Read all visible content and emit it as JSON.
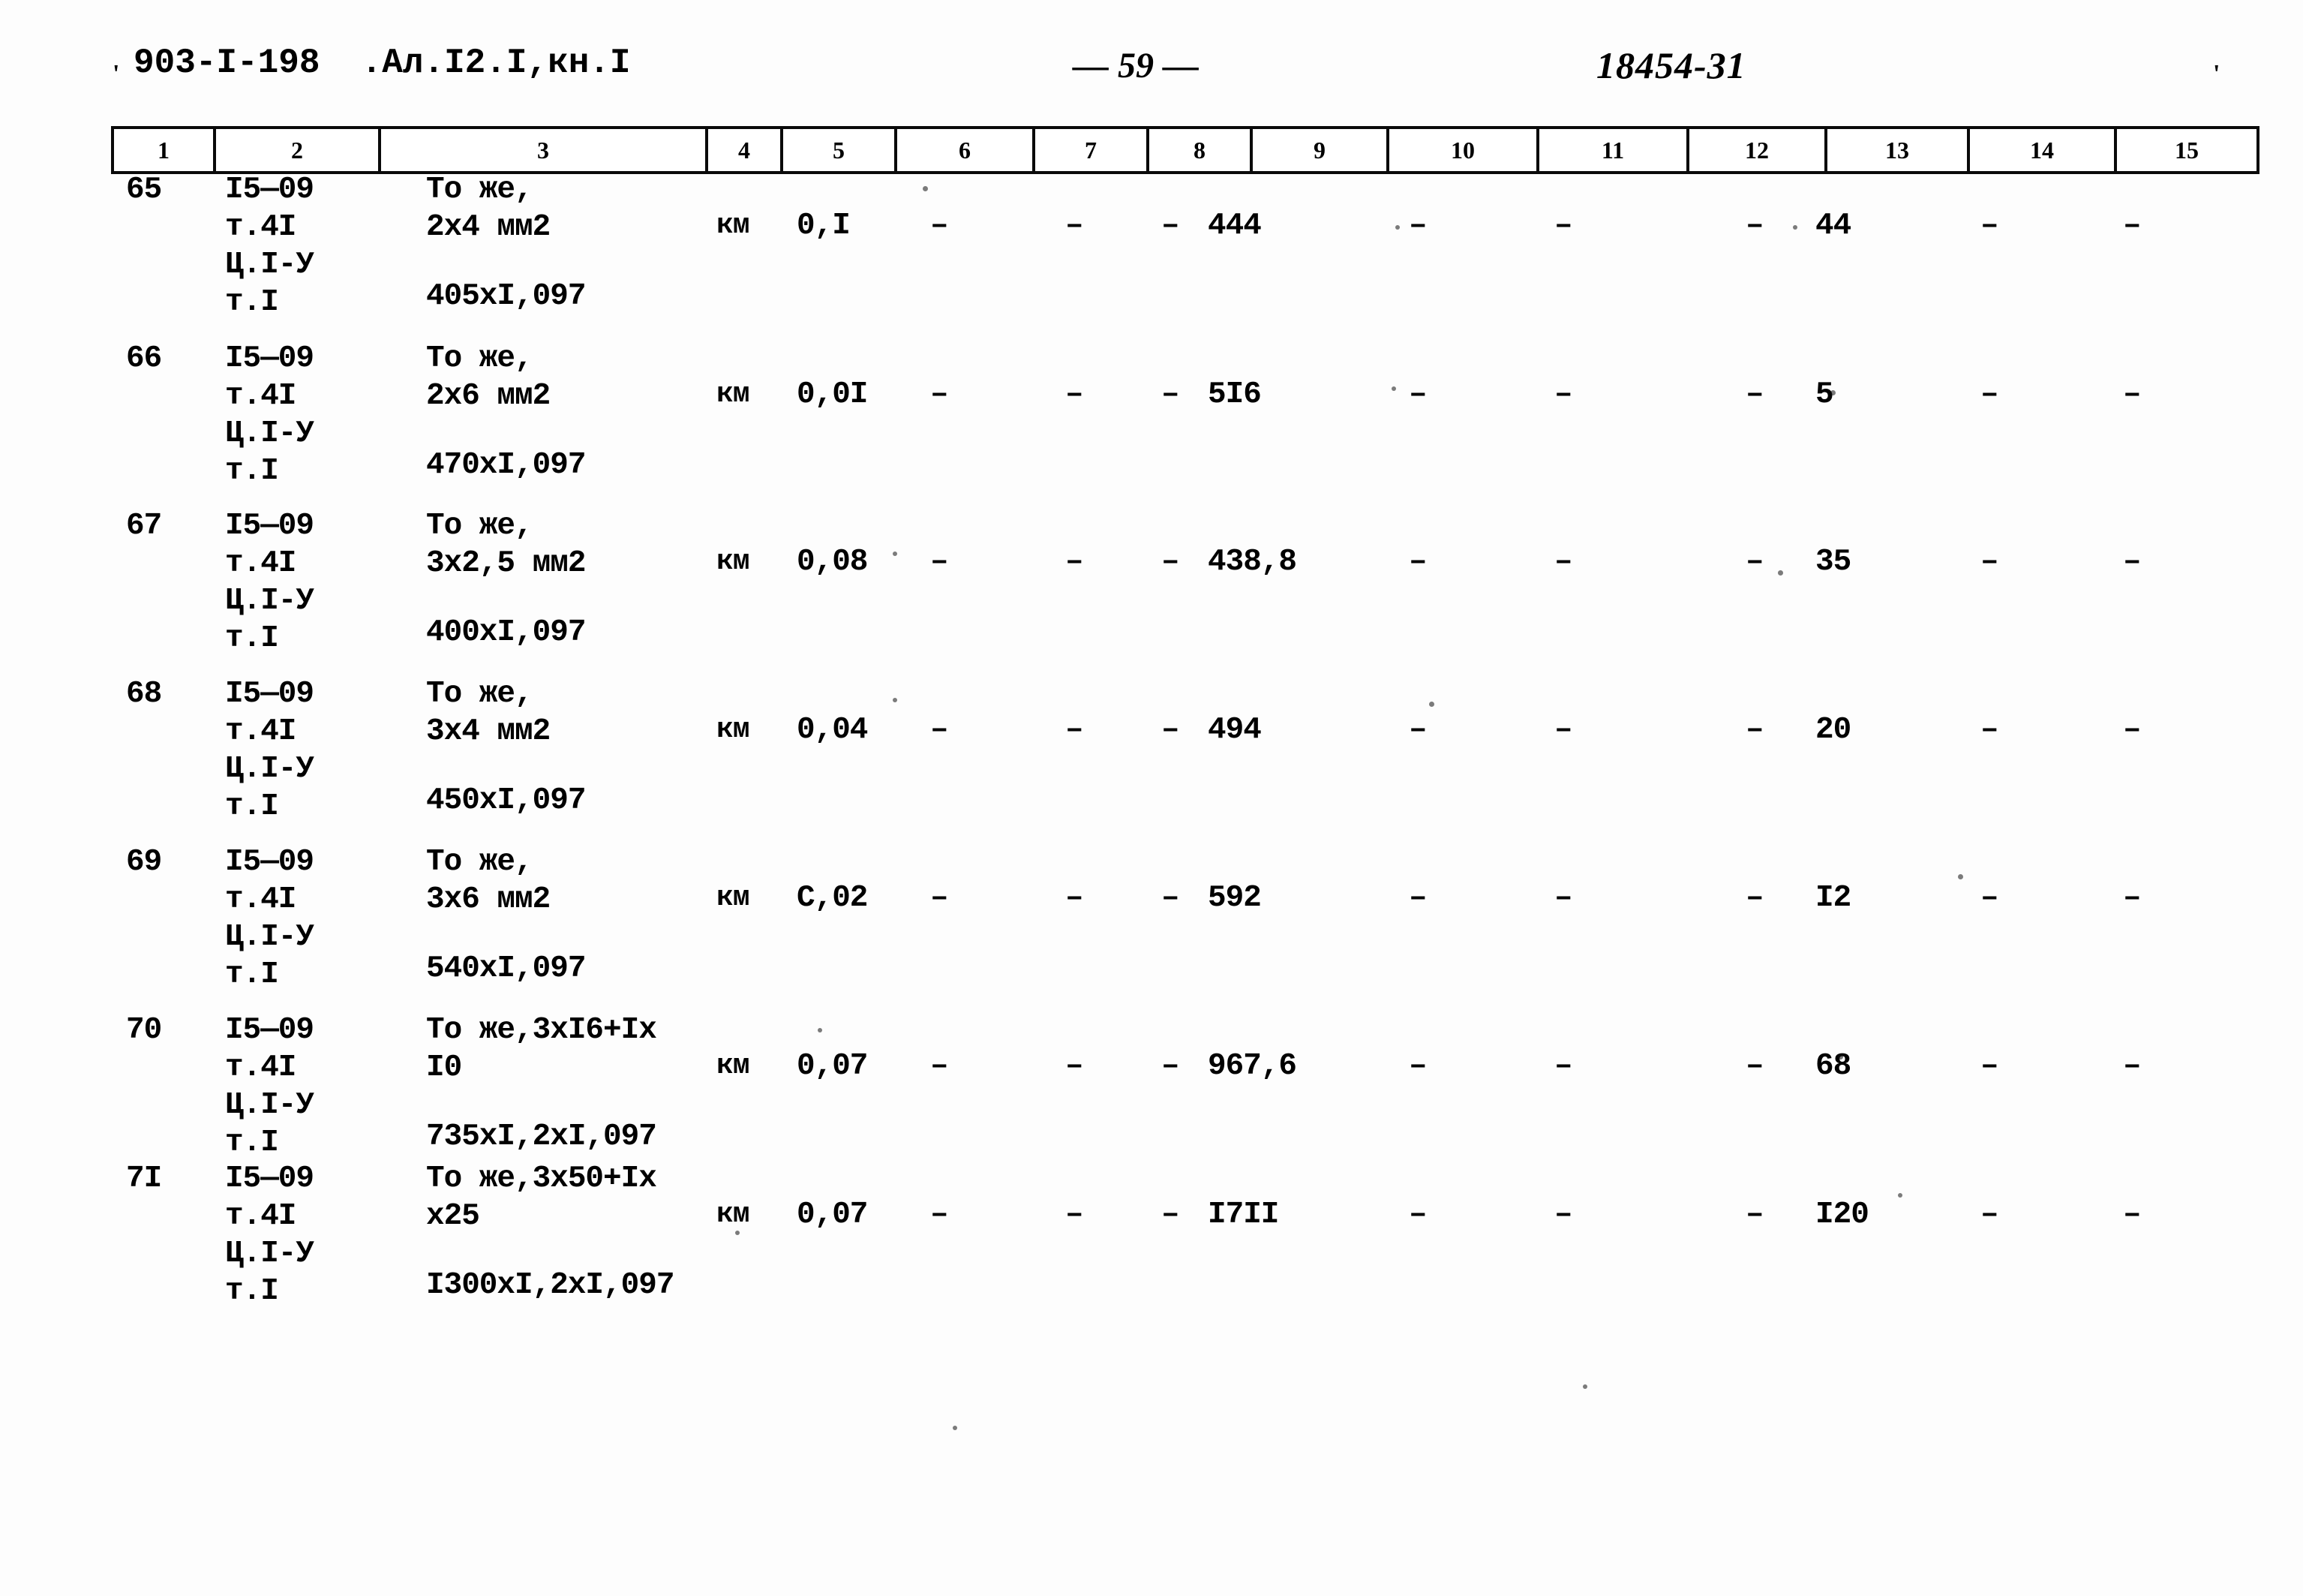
{
  "header": {
    "left_code": "903-I-198  .Ал.I2.I,кн.I",
    "tick_left": "'",
    "tick_right": "'",
    "page_marker": "— 59 —",
    "right_code": "18454-31"
  },
  "table": {
    "column_numbers": [
      "1",
      "2",
      "3",
      "4",
      "5",
      "6",
      "7",
      "8",
      "9",
      "10",
      "11",
      "12",
      "13",
      "14",
      "15"
    ],
    "rows": [
      {
        "c1": "65",
        "c2": "I5—09\nт.4I\nЦ.I-У\nт.I",
        "c3": "То же,\n2х4 мм2",
        "c3b": "405хI,097",
        "c4": "км",
        "c5": "0,I",
        "c6": "–",
        "c7": "–",
        "c8": "–",
        "c9": "444",
        "c10": "–",
        "c11": "–",
        "c12": "–",
        "c13": "44",
        "c14": "–",
        "c15": "–"
      },
      {
        "c1": "66",
        "c2": "I5—09\nт.4I\nЦ.I-У\nт.I",
        "c3": "То же,\n2х6 мм2",
        "c3b": "470хI,097",
        "c4": "км",
        "c5": "0,0I",
        "c6": "–",
        "c7": "–",
        "c8": "–",
        "c9": "5I6",
        "c10": "–",
        "c11": "–",
        "c12": "–",
        "c13": "5",
        "c14": "–",
        "c15": "–"
      },
      {
        "c1": "67",
        "c2": "I5—09\nт.4I\nЦ.I-У\nт.I",
        "c3": "То же,\n3х2,5 мм2",
        "c3b": "400хI,097",
        "c4": "км",
        "c5": "0,08",
        "c6": "–",
        "c7": "–",
        "c8": "–",
        "c9": "438,8",
        "c10": "–",
        "c11": "–",
        "c12": "–",
        "c13": "35",
        "c14": "–",
        "c15": "–"
      },
      {
        "c1": "68",
        "c2": "I5—09\nт.4I\nЦ.I-У\nт.I",
        "c3": "То же,\n3х4 мм2",
        "c3b": "450хI,097",
        "c4": "км",
        "c5": "0,04",
        "c6": "–",
        "c7": "–",
        "c8": "–",
        "c9": "494",
        "c10": "–",
        "c11": "–",
        "c12": "–",
        "c13": "20",
        "c14": "–",
        "c15": "–"
      },
      {
        "c1": "69",
        "c2": "I5—09\nт.4I\nЦ.I-У\nт.I",
        "c3": "То же,\n3х6 мм2",
        "c3b": "540хI,097",
        "c4": "км",
        "c5": "С,02",
        "c6": "–",
        "c7": "–",
        "c8": "–",
        "c9": "592",
        "c10": "–",
        "c11": "–",
        "c12": "–",
        "c13": "I2",
        "c14": "–",
        "c15": "–"
      },
      {
        "c1": "70",
        "c2": "I5—09\nт.4I\nЦ.I-У\nт.I",
        "c3": "То же,3хI6+Iх\nI0",
        "c3b": "735хI,2хI,097",
        "c4": "км",
        "c5": "0,07",
        "c6": "–",
        "c7": "–",
        "c8": "–",
        "c9": "967,6",
        "c10": "–",
        "c11": "–",
        "c12": "–",
        "c13": "68",
        "c14": "–",
        "c15": "–"
      },
      {
        "c1": "7I",
        "c2": "I5—09\nт.4I\nЦ.I-У\nт.I",
        "c3": "То же,3х50+Iх\nх25",
        "c3b": "I300хI,2хI,097",
        "c4": "км",
        "c5": "0,07",
        "c6": "–",
        "c7": "–",
        "c8": "–",
        "c9": "I7II",
        "c10": "–",
        "c11": "–",
        "c12": "–",
        "c13": "I20",
        "c14": "–",
        "c15": "–"
      }
    ]
  }
}
